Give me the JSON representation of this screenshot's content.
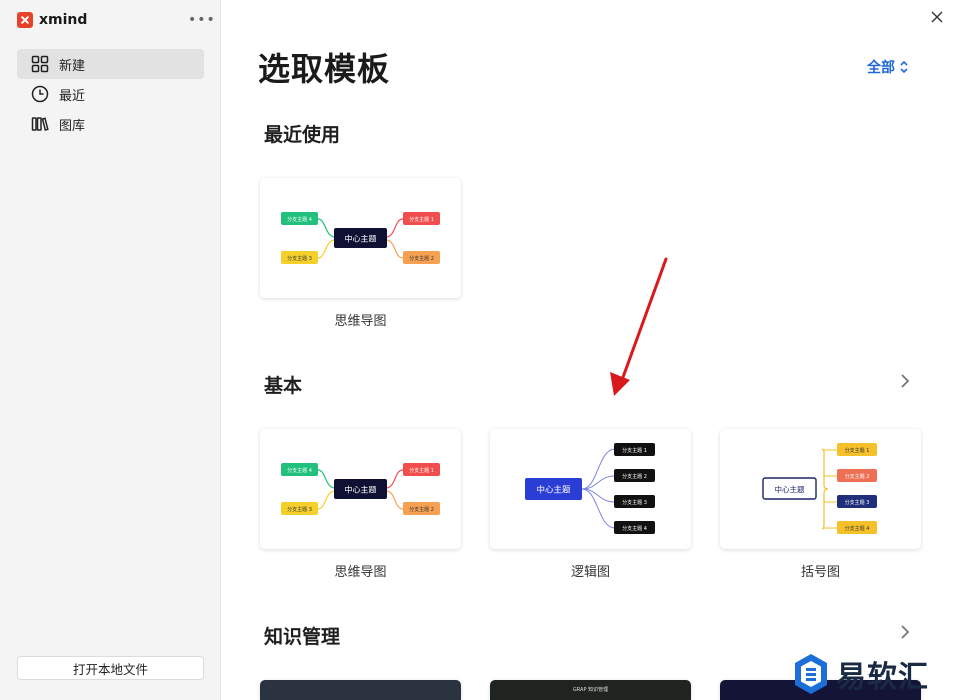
{
  "app": {
    "brand": "xmind",
    "more_label": "•••"
  },
  "sidebar": {
    "items": [
      {
        "label": "新建",
        "icon": "grid-icon",
        "active": true
      },
      {
        "label": "最近",
        "icon": "clock-icon",
        "active": false
      },
      {
        "label": "图库",
        "icon": "library-icon",
        "active": false
      }
    ],
    "open_local_label": "打开本地文件"
  },
  "main": {
    "title": "选取模板",
    "filter_label": "全部",
    "sections": [
      {
        "title": "最近使用",
        "cards": [
          {
            "label": "思维导图"
          }
        ]
      },
      {
        "title": "基本",
        "cards": [
          {
            "label": "思维导图"
          },
          {
            "label": "逻辑图"
          },
          {
            "label": "括号图"
          }
        ]
      },
      {
        "title": "知识管理",
        "cards": [
          {
            "label": ""
          },
          {
            "label": ""
          },
          {
            "label": ""
          }
        ]
      }
    ]
  },
  "thumbs": {
    "mindmap": {
      "center": "中心主题",
      "b1": "分支主题 1",
      "b2": "分支主题 2",
      "b3": "分支主题 3",
      "b4": "分支主题 4"
    },
    "logic": {
      "center": "中心主题",
      "b1": "分支主题 1",
      "b2": "分支主题 2",
      "b3": "分支主题 3",
      "b4": "分支主题 4"
    },
    "brace": {
      "center": "中心主题",
      "b1": "分支主题 1",
      "b2": "分支主题 2",
      "b3": "分支主题 3",
      "b4": "分支主题 4"
    },
    "dark2_caption": "GRAP 知识管理"
  },
  "watermark": {
    "text": "易软汇"
  },
  "colors": {
    "accent": "#2167d6",
    "annotation_arrow": "#d9191c",
    "mindmap_center": "#0f1033",
    "logic_center": "#2a3ed6",
    "branch_red": "#f24d4d",
    "branch_orange": "#f6a052",
    "branch_green": "#21c07c",
    "branch_yellow": "#f6d02a"
  }
}
